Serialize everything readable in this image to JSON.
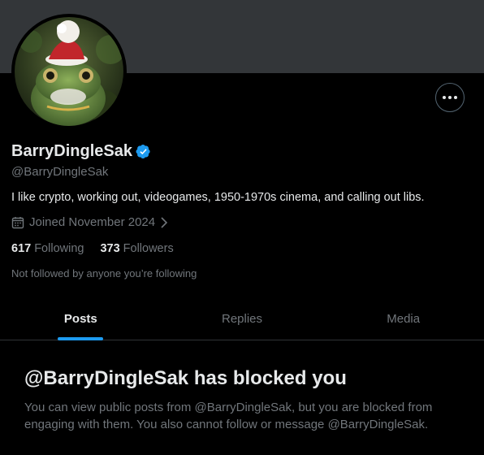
{
  "profile": {
    "display_name": "BarryDingleSak",
    "handle": "@BarryDingleSak",
    "bio": "I like crypto, working out, videogames, 1950-1970s cinema, and calling out libs.",
    "joined": "Joined November 2024",
    "following_count": "617",
    "following_label": "Following",
    "followers_count": "373",
    "followers_label": "Followers",
    "not_followed_text": "Not followed by anyone you’re following"
  },
  "icons": {
    "verified": "verified-badge-icon",
    "calendar": "calendar-icon",
    "chevron": "chevron-right-icon",
    "more": "more-dots-icon"
  },
  "tabs": [
    {
      "label": "Posts",
      "active": true
    },
    {
      "label": "Replies",
      "active": false
    },
    {
      "label": "Media",
      "active": false
    }
  ],
  "blocked": {
    "title": "@BarryDingleSak has blocked you",
    "description": "You can view public posts from @BarryDingleSak, but you are blocked from engaging with them. You also cannot follow or message @BarryDingleSak."
  },
  "colors": {
    "background": "#000000",
    "banner": "#333639",
    "accent": "#1d9bf0",
    "secondary_text": "#71767b",
    "primary_text": "#e7e9ea"
  }
}
